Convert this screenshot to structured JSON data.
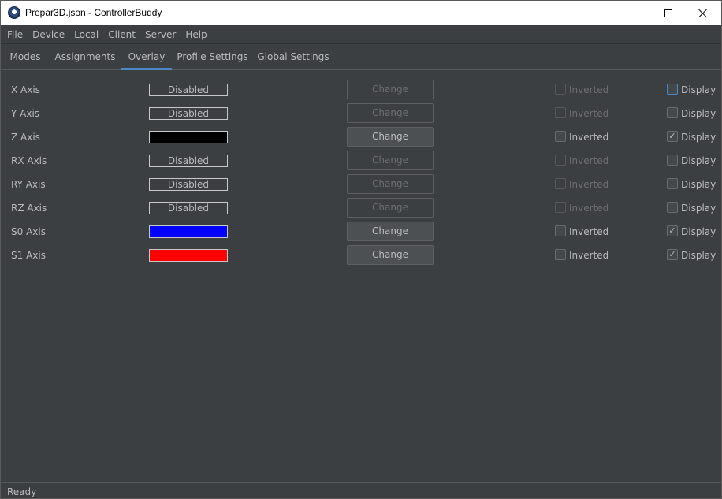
{
  "window": {
    "title": "Prepar3D.json - ControllerBuddy"
  },
  "menu": [
    "File",
    "Device",
    "Local",
    "Client",
    "Server",
    "Help"
  ],
  "tabs": [
    {
      "label": "Modes",
      "active": false
    },
    {
      "label": "Assignments",
      "active": false
    },
    {
      "label": "Overlay",
      "active": true
    },
    {
      "label": "Profile Settings",
      "active": false
    },
    {
      "label": "Global Settings",
      "active": false
    }
  ],
  "rows": [
    {
      "axis": "X Axis",
      "color_text": "Disabled",
      "color": "",
      "change": "Change",
      "change_enabled": false,
      "inverted_label": "Inverted",
      "inverted_enabled": false,
      "inverted_checked": false,
      "display_label": "Display",
      "display_checked": false
    },
    {
      "axis": "Y Axis",
      "color_text": "Disabled",
      "color": "",
      "change": "Change",
      "change_enabled": false,
      "inverted_label": "Inverted",
      "inverted_enabled": false,
      "inverted_checked": false,
      "display_label": "Display",
      "display_checked": false
    },
    {
      "axis": "Z Axis",
      "color_text": "",
      "color": "#000000",
      "change": "Change",
      "change_enabled": true,
      "inverted_label": "Inverted",
      "inverted_enabled": true,
      "inverted_checked": false,
      "display_label": "Display",
      "display_checked": true
    },
    {
      "axis": "RX Axis",
      "color_text": "Disabled",
      "color": "",
      "change": "Change",
      "change_enabled": false,
      "inverted_label": "Inverted",
      "inverted_enabled": false,
      "inverted_checked": false,
      "display_label": "Display",
      "display_checked": false
    },
    {
      "axis": "RY Axis",
      "color_text": "Disabled",
      "color": "",
      "change": "Change",
      "change_enabled": false,
      "inverted_label": "Inverted",
      "inverted_enabled": false,
      "inverted_checked": false,
      "display_label": "Display",
      "display_checked": false
    },
    {
      "axis": "RZ Axis",
      "color_text": "Disabled",
      "color": "",
      "change": "Change",
      "change_enabled": false,
      "inverted_label": "Inverted",
      "inverted_enabled": false,
      "inverted_checked": false,
      "display_label": "Display",
      "display_checked": false
    },
    {
      "axis": "S0 Axis",
      "color_text": "",
      "color": "#0000ff",
      "change": "Change",
      "change_enabled": true,
      "inverted_label": "Inverted",
      "inverted_enabled": true,
      "inverted_checked": false,
      "display_label": "Display",
      "display_checked": true
    },
    {
      "axis": "S1 Axis",
      "color_text": "",
      "color": "#ff0000",
      "change": "Change",
      "change_enabled": true,
      "inverted_label": "Inverted",
      "inverted_enabled": true,
      "inverted_checked": false,
      "display_label": "Display",
      "display_checked": true
    }
  ],
  "status": "Ready",
  "icons": {
    "app": "controllerbuddy-app-icon",
    "minimize": "minimize-icon",
    "maximize": "maximize-icon",
    "close": "close-icon",
    "check": "checkmark-icon"
  },
  "colors": {
    "background": "#3c3f41",
    "accent": "#4a88c7",
    "text": "#bbbbbb",
    "disabled_text": "#6e6e6e"
  }
}
